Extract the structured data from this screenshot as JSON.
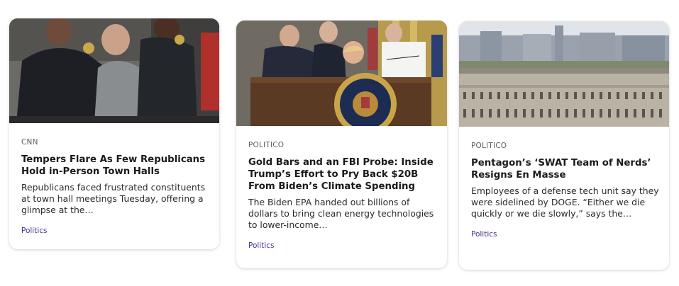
{
  "cards": [
    {
      "source": "CNN",
      "headline": "Tempers Flare As Few Republicans Hold in-Person Town Halls",
      "summary": "Republicans faced frustrated constituents at town hall meetings Tuesday, offering a glimpse at the…",
      "category": "Politics",
      "image": "town-hall-arrest-photo"
    },
    {
      "source": "POLITICO",
      "headline": "Gold Bars and an FBI Probe: Inside Trump’s Effort to Pry Back $20B From Biden’s Climate Spending",
      "summary": "The Biden EPA handed out billions of dollars to bring clean energy technologies to lower-income…",
      "category": "Politics",
      "image": "oval-office-signing-photo"
    },
    {
      "source": "POLITICO",
      "headline": "Pentagon’s ‘SWAT Team of Nerds’ Resigns En Masse",
      "summary": "Employees of a defense tech unit say they were sidelined by DOGE. “Either we die quickly or we die slowly,” says the…",
      "category": "Politics",
      "image": "pentagon-building-photo"
    }
  ]
}
